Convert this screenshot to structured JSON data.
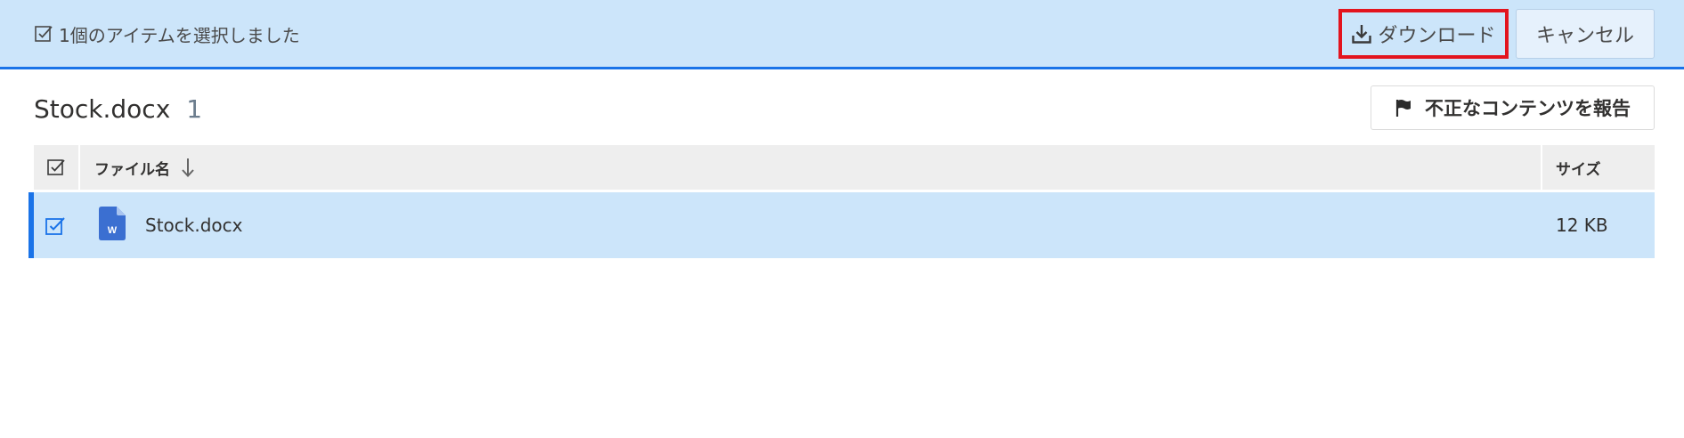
{
  "command_bar": {
    "selection_text": "1個のアイテムを選択しました",
    "download_label": "ダウンロード",
    "cancel_label": "キャンセル"
  },
  "header": {
    "title": "Stock.docx",
    "count": "1",
    "report_label": "不正なコンテンツを報告"
  },
  "table": {
    "columns": {
      "name": "ファイル名",
      "size": "サイズ"
    },
    "rows": [
      {
        "name": "Stock.docx",
        "size": "12 KB",
        "icon": "word-doc-icon",
        "selected": true
      }
    ]
  },
  "colors": {
    "accent": "#1a73e8",
    "selection_bg": "#cce5fa",
    "highlight_box": "#e3141e",
    "word_icon": "#3b6fd1"
  }
}
